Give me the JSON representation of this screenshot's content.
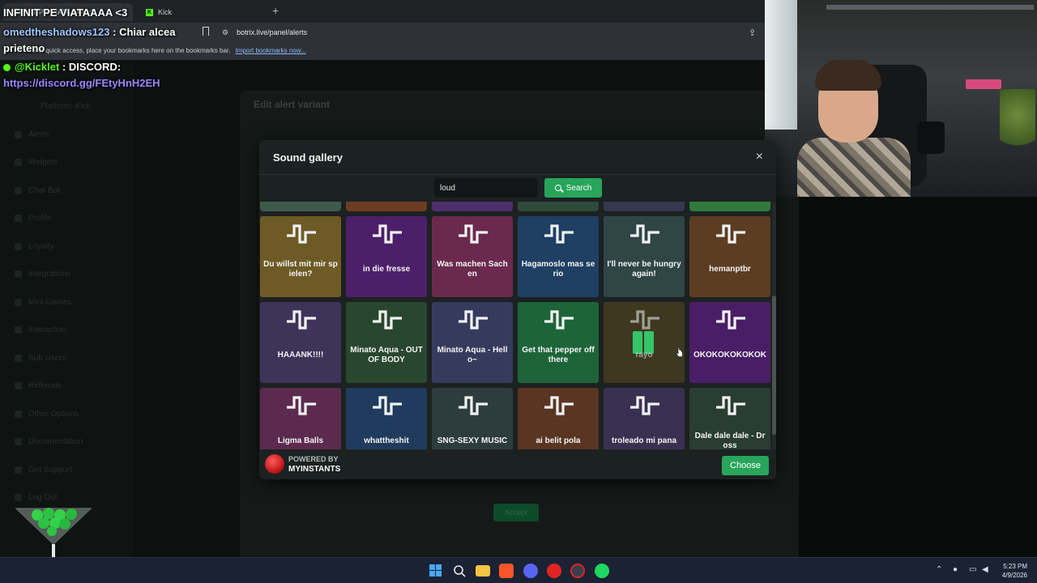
{
  "browser": {
    "tab_active_label": "INFINIT PE VIATAAAA <3",
    "tab_kick_label": "Kick",
    "new_tab_glyph": "+",
    "url": "botrix.live/panel/alerts",
    "bookmarks_hint": "For quick access, place your bookmarks here on the bookmarks bar.",
    "bookmarks_import": "Import bookmarks now..."
  },
  "overlay": {
    "title": "INFINIT PE VIATAAAA <3",
    "chat": [
      {
        "user": "omedtheshadows123",
        "sep": " : ",
        "message": "Chiar alcea"
      },
      {
        "user": "",
        "sep": "",
        "message": "prieteno"
      },
      {
        "user": "@Kicklet",
        "sep": " : ",
        "message": "DISCORD:"
      }
    ],
    "discord_link": "https://discord.gg/FEtyHnH2EH"
  },
  "backdrop": {
    "panel_title": "Edit alert variant",
    "accept_label": "Accept",
    "sidebar": [
      "Platform: Kick",
      "Alerts",
      "Widgets",
      "Chat Bot",
      "Profile",
      "Loyalty",
      "Integrations",
      "Mini Games",
      "Interaction",
      "Sub Users",
      "Referrals",
      "Other Options",
      "Documentation",
      "Get Support",
      "Log Out"
    ]
  },
  "modal": {
    "title": "Sound gallery",
    "close_glyph": "×",
    "search_value": "loud",
    "search_button": "Search",
    "powered_by": "POWERED BY",
    "powered_brand": "MYINSTANTS",
    "choose_button": "Choose",
    "peek_colors": [
      "#3d5a4a",
      "#6b3c22",
      "#4e2e6b",
      "#2d4a3a",
      "#35384f",
      "#2f7b3c"
    ],
    "sounds": [
      {
        "label": "Du willst mit mir spielen?",
        "color": "#6e5a25",
        "icon": "waveform-icon"
      },
      {
        "label": "in die fresse",
        "color": "#4d1f6b",
        "icon": "waveform-icon"
      },
      {
        "label": "Was machen Sachen",
        "color": "#6b2a4d",
        "icon": "waveform-icon"
      },
      {
        "label": "Hagamoslo mas serio",
        "color": "#1f3f63",
        "icon": "waveform-icon"
      },
      {
        "label": "I'll never be hungry again!",
        "color": "#304545",
        "icon": "waveform-icon"
      },
      {
        "label": "hemanptbr",
        "color": "#5c3d22",
        "icon": "waveform-icon"
      },
      {
        "label": "HAAANK!!!!",
        "color": "#3e3459",
        "icon": "waveform-icon"
      },
      {
        "label": "Minato Aqua - OUT OF BODY",
        "color": "#29472f",
        "icon": "waveform-icon"
      },
      {
        "label": "Minato Aqua - Hello~",
        "color": "#363b5e",
        "icon": "waveform-icon"
      },
      {
        "label": "Get that pepper off there",
        "color": "#1e6439",
        "icon": "waveform-icon"
      },
      {
        "label": "rayo",
        "color": "#3e3820",
        "icon": "waveform-icon",
        "playing": true
      },
      {
        "label": "OKOKOKOKOKOK",
        "color": "#4a1e66",
        "icon": "waveform-icon"
      },
      {
        "label": "Ligma Balls",
        "color": "#5c2a4f",
        "icon": "waveform-icon"
      },
      {
        "label": "whattheshit",
        "color": "#1f3b5e",
        "icon": "waveform-icon"
      },
      {
        "label": "SNG-SEXY MUSIC",
        "color": "#2d3d3d",
        "icon": "waveform-icon"
      },
      {
        "label": "ai belit pola",
        "color": "#5a3522",
        "icon": "waveform-icon"
      },
      {
        "label": "troleado mi pana",
        "color": "#3a3152",
        "icon": "waveform-icon"
      },
      {
        "label": "Dale dale dale - Dross",
        "color": "#2a3d32",
        "icon": "waveform-icon"
      }
    ]
  },
  "taskbar": {
    "time": "5:23 PM",
    "date": "4/9/2026",
    "accent_colors": {
      "start": "#49a8ff",
      "brave": "#fb542b",
      "discord": "#5865f2",
      "youtube": "#e02424",
      "spotify": "#1ed760",
      "files": "#f4c542"
    }
  }
}
